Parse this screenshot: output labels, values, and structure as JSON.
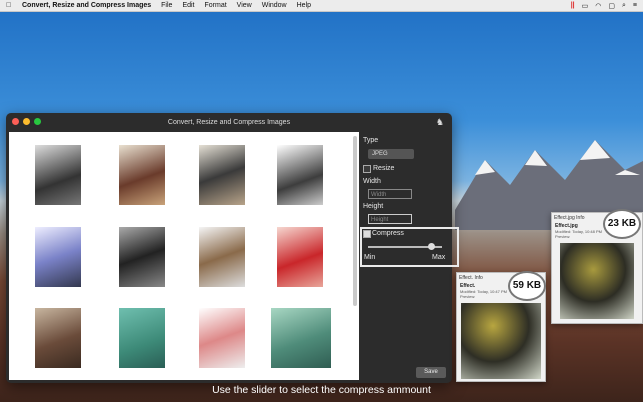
{
  "menubar": {
    "app_name": "Convert, Resize and Compress Images",
    "items": [
      "File",
      "Edit",
      "Format",
      "View",
      "Window",
      "Help"
    ]
  },
  "window": {
    "title": "Convert, Resize and Compress Images"
  },
  "panel": {
    "type_label": "Type",
    "type_value": "JPEG",
    "resize_label": "Resize",
    "width_label": "Width",
    "width_placeholder": "Width",
    "height_label": "Height",
    "height_placeholder": "Height",
    "compress_label": "Compress",
    "min_label": "Min",
    "max_label": "Max",
    "compress_level": 0.9,
    "save_label": "Save"
  },
  "preview_large": {
    "title": "Effect.jpg Info",
    "file": "Effect.jpg",
    "modified": "Modified: Today, 10:48 PM",
    "size": "23 KB",
    "section": "Preview:"
  },
  "preview_small": {
    "title": "Effect. Info",
    "file": "Effect.",
    "modified": "Modified: Today, 10:47 PM",
    "size": "59 KB",
    "section": "Preview:"
  },
  "caption": "Use the slider to select the compress ammount",
  "thumbnails": [
    "thumb-1",
    "thumb-2",
    "thumb-3",
    "thumb-4",
    "thumb-5",
    "thumb-6",
    "thumb-7",
    "thumb-8",
    "thumb-9",
    "thumb-10",
    "thumb-11",
    "thumb-12"
  ]
}
